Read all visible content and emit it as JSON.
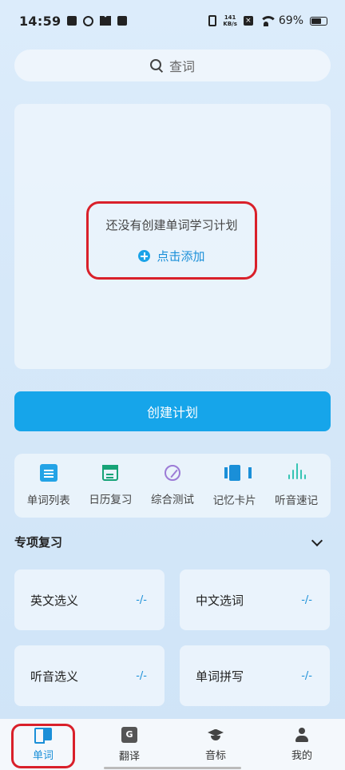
{
  "status_bar": {
    "time": "14:59",
    "speed_value": "141",
    "speed_unit": "KB/s",
    "battery": "69%"
  },
  "search": {
    "label": "查词"
  },
  "plan": {
    "empty_text": "还没有创建单词学习计划",
    "add_label": "点击添加",
    "create_button": "创建计划"
  },
  "tools": [
    {
      "label": "单词列表",
      "icon": "doc-icon"
    },
    {
      "label": "日历复习",
      "icon": "calendar-icon"
    },
    {
      "label": "综合测试",
      "icon": "quiz-icon"
    },
    {
      "label": "记忆卡片",
      "icon": "cards-icon"
    },
    {
      "label": "听音速记",
      "icon": "wave-icon"
    }
  ],
  "review": {
    "title": "专项复习",
    "items": [
      {
        "label": "英文选义",
        "score": "-/-"
      },
      {
        "label": "中文选词",
        "score": "-/-"
      },
      {
        "label": "听音选义",
        "score": "-/-"
      },
      {
        "label": "单词拼写",
        "score": "-/-"
      }
    ]
  },
  "nav": [
    {
      "label": "单词",
      "icon": "book-icon",
      "active": true
    },
    {
      "label": "翻译",
      "icon": "translate-icon",
      "icon_text": "G",
      "active": false
    },
    {
      "label": "音标",
      "icon": "cap-icon",
      "active": false
    },
    {
      "label": "我的",
      "icon": "person-icon",
      "active": false
    }
  ],
  "colors": {
    "accent": "#16a5ea",
    "highlight_border": "#d9202a"
  }
}
